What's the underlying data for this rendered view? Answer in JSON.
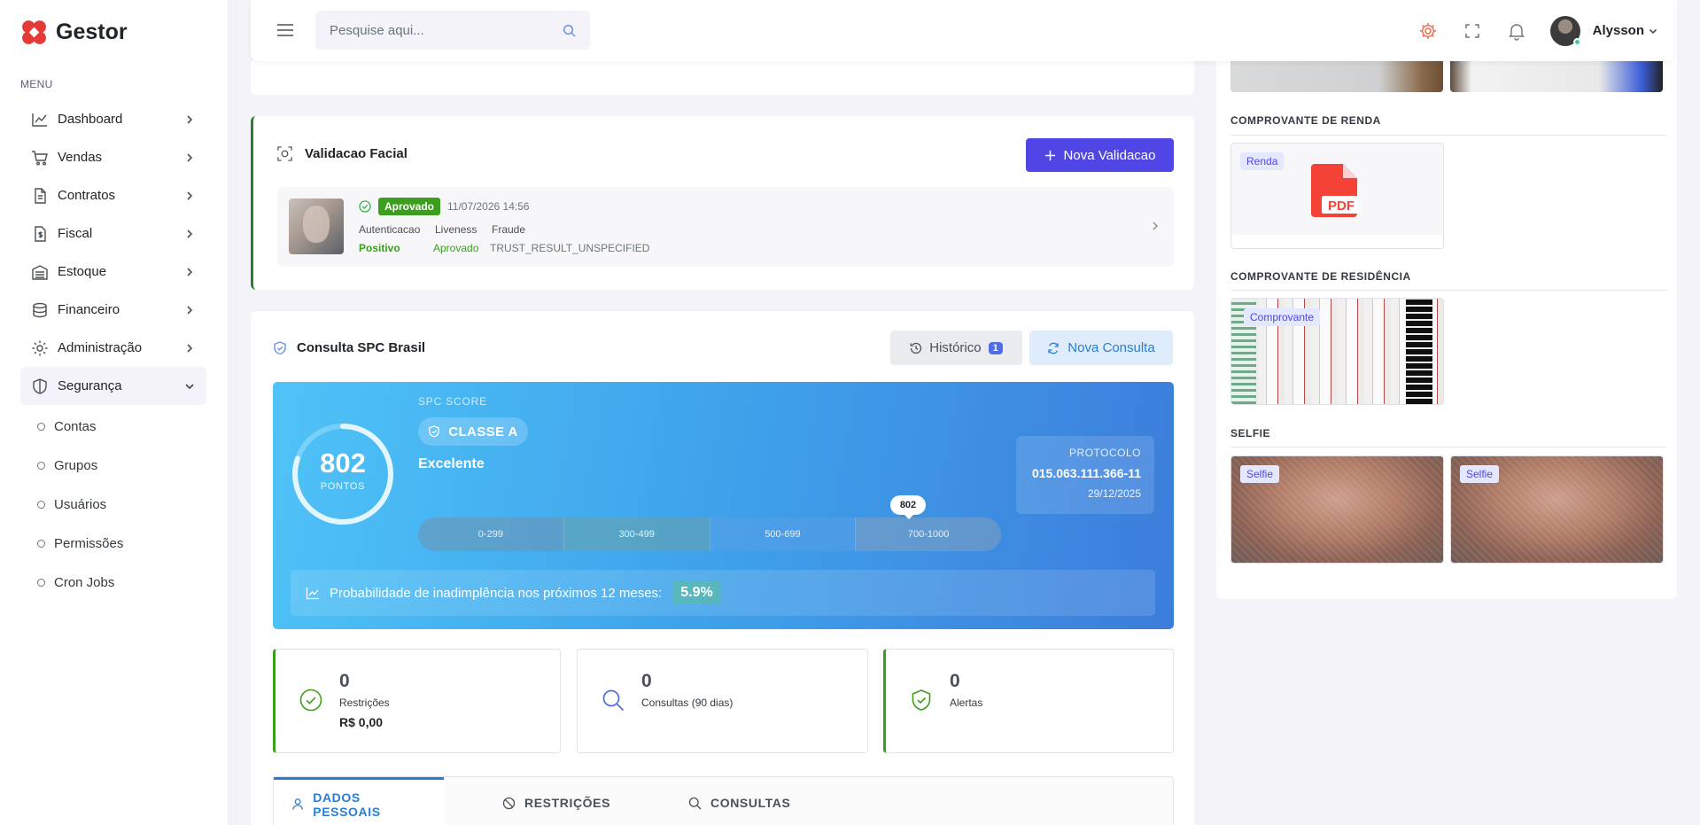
{
  "app": {
    "name": "Gestor"
  },
  "sidebar": {
    "menu_title": "MENU",
    "items": [
      {
        "label": "Dashboard",
        "icon": "chart-line-icon"
      },
      {
        "label": "Vendas",
        "icon": "cart-icon"
      },
      {
        "label": "Contratos",
        "icon": "file-icon"
      },
      {
        "label": "Fiscal",
        "icon": "dollar-file-icon"
      },
      {
        "label": "Estoque",
        "icon": "warehouse-icon"
      },
      {
        "label": "Financeiro",
        "icon": "coins-icon"
      },
      {
        "label": "Administração",
        "icon": "gear-icon"
      },
      {
        "label": "Segurança",
        "icon": "shield-icon"
      }
    ],
    "sub_items": [
      "Contas",
      "Grupos",
      "Usuários",
      "Permissões",
      "Cron Jobs"
    ]
  },
  "topbar": {
    "search_placeholder": "Pesquise aqui...",
    "user_name": "Alysson"
  },
  "facial": {
    "title": "Validacao Facial",
    "button": "Nova Validacao",
    "status": "Aprovado",
    "datetime": "11/07/2026 14:56",
    "labels": [
      "Autenticacao",
      "Liveness",
      "Fraude"
    ],
    "values": [
      "Positivo",
      "Aprovado",
      "TRUST_RESULT_UNSPECIFIED"
    ]
  },
  "spc": {
    "title": "Consulta SPC Brasil",
    "history_button": "Histórico",
    "history_count": "1",
    "new_button": "Nova Consulta",
    "score_label": "SPC SCORE",
    "score": "802",
    "score_value": 802,
    "score_max": 1000,
    "points_label": "PONTOS",
    "classe": "CLASSE A",
    "category": "Excelente",
    "ranges": [
      "0-299",
      "300-499",
      "500-699",
      "700-1000"
    ],
    "protocol_label": "PROTOCOLO",
    "protocol": "015.063.111.366-11",
    "protocol_date": "29/12/2025",
    "probability_text": "Probabilidade de inadimplência nos próximos 12 meses:",
    "probability": "5.9%",
    "stats": [
      {
        "value": "0",
        "label": "Restrições",
        "amount": "R$ 0,00"
      },
      {
        "value": "0",
        "label": "Consultas (90 dias)"
      },
      {
        "value": "0",
        "label": "Alertas"
      }
    ],
    "tabs": [
      "DADOS PESSOAIS",
      "RESTRIÇÕES",
      "CONSULTAS"
    ]
  },
  "docs": {
    "renda_title": "COMPROVANTE DE RENDA",
    "renda_tag": "Renda",
    "residencia_title": "COMPROVANTE DE RESIDÊNCIA",
    "residencia_tag": "Comprovante",
    "selfie_title": "SELFIE",
    "selfie_tag": "Selfie"
  }
}
